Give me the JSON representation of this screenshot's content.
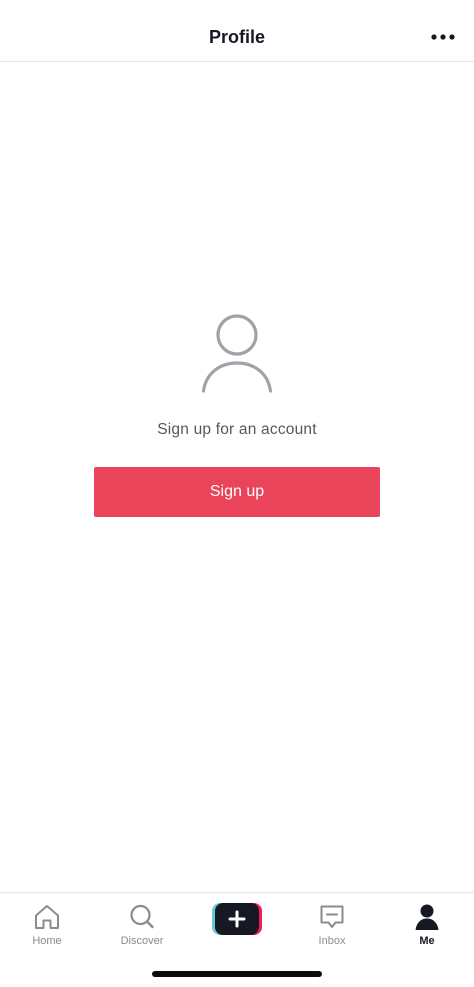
{
  "header": {
    "title": "Profile",
    "more_icon": "more-horizontal-icon"
  },
  "main": {
    "avatar_icon": "person-outline-icon",
    "prompt": "Sign up for an account",
    "signup_label": "Sign up"
  },
  "bottom_nav": {
    "items": [
      {
        "label": "Home",
        "icon": "home-icon",
        "active": false
      },
      {
        "label": "Discover",
        "icon": "search-icon",
        "active": false
      },
      {
        "label": "",
        "icon": "plus-icon",
        "active": false
      },
      {
        "label": "Inbox",
        "icon": "inbox-icon",
        "active": false
      },
      {
        "label": "Me",
        "icon": "person-icon",
        "active": true
      }
    ]
  },
  "colors": {
    "accent": "#ea445a",
    "text_primary": "#161823",
    "text_secondary": "#8a8b91",
    "icon_gray": "#a1a2a7",
    "create_cyan": "#69c9d0",
    "create_red": "#ee1d52"
  }
}
